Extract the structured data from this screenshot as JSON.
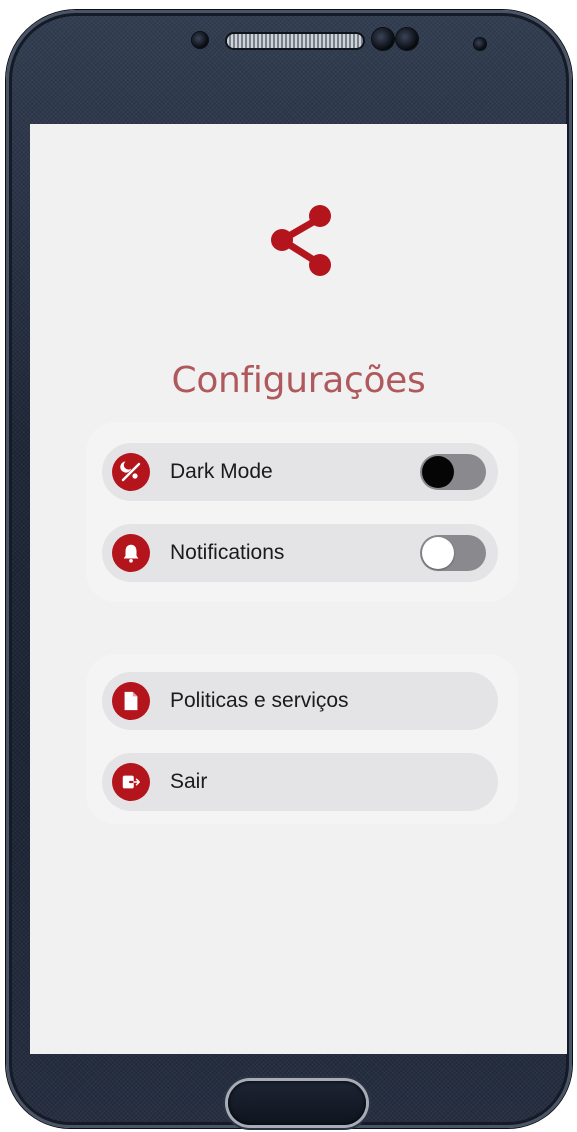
{
  "header": {
    "logo_icon": "share-icon",
    "title": "Configurações",
    "title_color": "#b0595c"
  },
  "settings": [
    {
      "label": "Dark Mode",
      "icon": "dark-mode-icon",
      "toggle": true,
      "enabled": false,
      "knob": "black"
    },
    {
      "label": "Notifications",
      "icon": "bell-icon",
      "toggle": true,
      "enabled": false,
      "knob": "white"
    }
  ],
  "actions": [
    {
      "label": "Politicas e serviços",
      "icon": "document-icon"
    },
    {
      "label": "Sair",
      "icon": "logout-icon"
    }
  ],
  "colors": {
    "accent": "#b4141c",
    "background": "#f1f1f2",
    "row_background": "#e4e4e6",
    "toggle_track": "#8a8a8e"
  }
}
